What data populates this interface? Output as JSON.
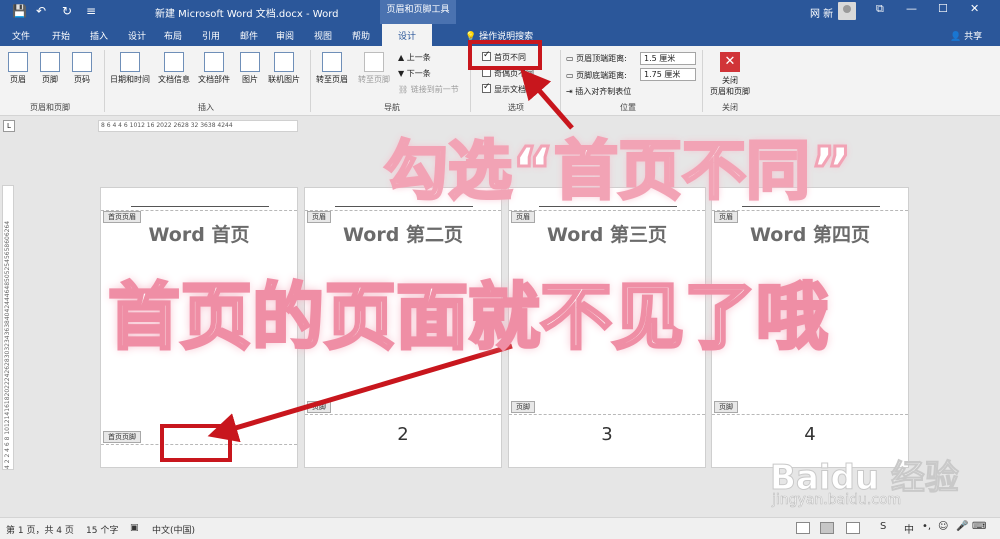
{
  "titlebar": {
    "doc_title": "新建 Microsoft Word 文档.docx - Word",
    "context_tools": "页眉和页脚工具",
    "user_name": "网 新",
    "icons": [
      "save-icon",
      "undo-icon",
      "redo-icon",
      "customize-icon"
    ]
  },
  "tabs": [
    "文件",
    "开始",
    "插入",
    "设计",
    "布局",
    "引用",
    "邮件",
    "审阅",
    "视图",
    "帮助"
  ],
  "active_tab": "设计",
  "search_tab": "操作说明搜索",
  "share": "共享",
  "ribbon": {
    "hf_group": {
      "header": "页眉",
      "footer": "页脚",
      "page_number": "页码",
      "label": "页眉和页脚"
    },
    "insert_group": {
      "datetime": "日期和时间",
      "docinfo": "文档信息",
      "docparts": "文档部件",
      "picture": "图片",
      "online_picture": "联机图片",
      "label": "插入"
    },
    "nav_group": {
      "goto_header": "转至页眉",
      "goto_footer": "转至页脚",
      "previous": "上一条",
      "next": "下一条",
      "link_previous": "链接到前一节",
      "label": "导航"
    },
    "options_group": {
      "different_first": "首页不同",
      "odd_even": "奇偶页不同",
      "show_text": "显示文档文字",
      "label": "选项"
    },
    "position_group": {
      "header_top": "页眉顶端距离:",
      "header_top_value": "1.5 厘米",
      "footer_bottom": "页脚底端距离:",
      "footer_bottom_value": "1.75 厘米",
      "align_tab": "插入对齐制表位",
      "label": "位置"
    },
    "close_group": {
      "close": "关闭",
      "close2": "页眉和页脚",
      "label": "关闭"
    }
  },
  "ruler_text": "8 6 4   4 6  1012  16  2022  2628  32  3638  4244",
  "vruler_text": "4 2   2 4 6 8 10121416182022242628303234363840424446485052545658606264",
  "pages": [
    {
      "heading": "Word 首页",
      "header_tag": "首页页眉",
      "footer_tag": "首页页脚",
      "number": ""
    },
    {
      "heading": "Word 第二页",
      "header_tag": "页眉",
      "footer_tag": "页脚",
      "number": "2"
    },
    {
      "heading": "Word 第三页",
      "header_tag": "页眉",
      "footer_tag": "页脚",
      "number": "3"
    },
    {
      "heading": "Word 第四页",
      "header_tag": "页眉",
      "footer_tag": "页脚",
      "number": "4"
    }
  ],
  "annotations": {
    "top": "勾选“首页不同”",
    "middle": "首页的页面就不见了哦",
    "color_highlight": "#c8161d"
  },
  "watermark": {
    "main": "Baidu 经验",
    "sub": "jingyan.baidu.com"
  },
  "status": {
    "page": "第 1 页，共 4 页",
    "words": "15 个字",
    "language": "中文(中国)"
  },
  "colors": {
    "brand": "#2b579a"
  }
}
